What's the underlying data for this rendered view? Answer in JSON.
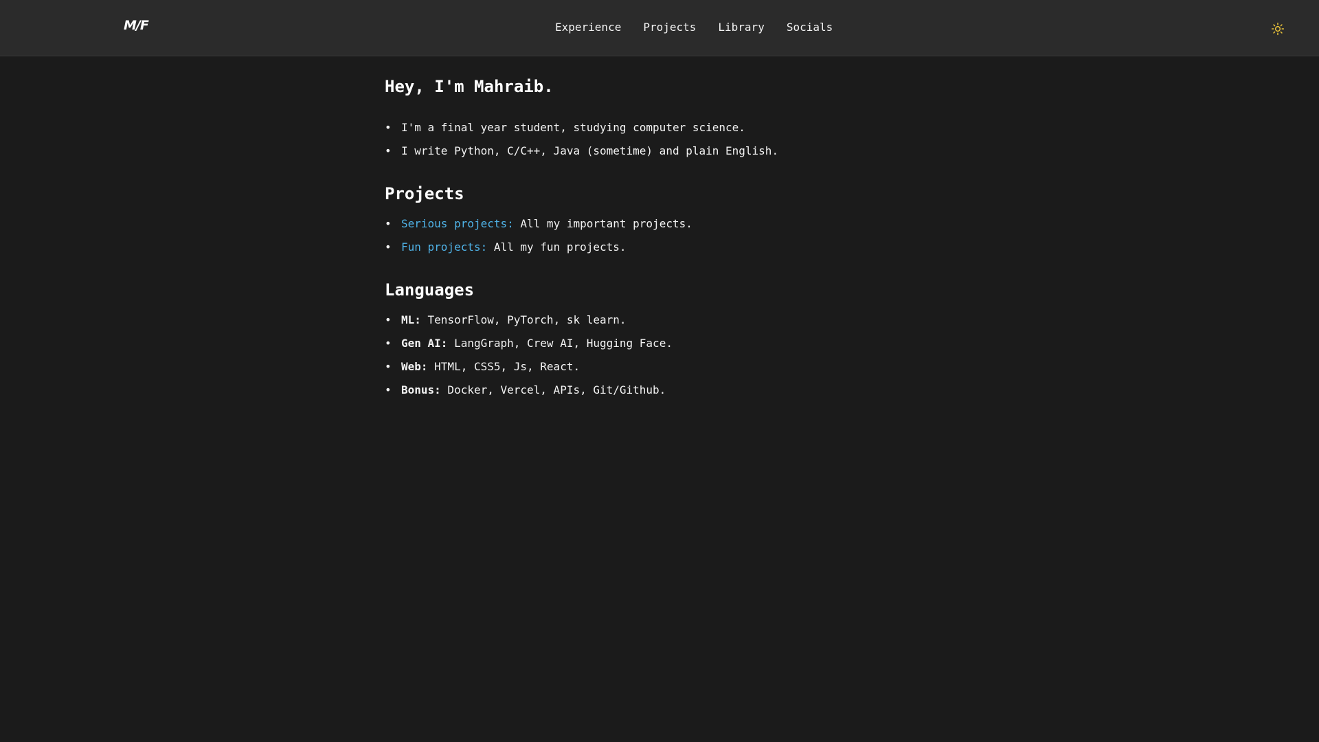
{
  "header": {
    "logo_text": "M/F",
    "nav": [
      {
        "label": "Experience"
      },
      {
        "label": "Projects"
      },
      {
        "label": "Library"
      },
      {
        "label": "Socials"
      }
    ],
    "theme_icon": "sun-icon",
    "theme_icon_color": "#e8c23a"
  },
  "intro": {
    "title": "Hey, I'm Mahraib.",
    "items": [
      "I'm a final year student, studying computer science.",
      "I write Python, C/C++, Java (sometime) and plain English."
    ]
  },
  "projects": {
    "title": "Projects",
    "items": [
      {
        "link": "Serious projects:",
        "text": " All my important projects."
      },
      {
        "link": "Fun projects:",
        "text": " All my fun projects."
      }
    ],
    "link_color": "#4fb3e8"
  },
  "languages": {
    "title": "Languages",
    "items": [
      {
        "label": "ML:",
        "text": " TensorFlow, PyTorch, sk learn."
      },
      {
        "label": "Gen AI:",
        "text": " LangGraph, Crew AI, Hugging Face."
      },
      {
        "label": "Web:",
        "text": " HTML, CSS5, Js, React."
      },
      {
        "label": "Bonus:",
        "text": " Docker, Vercel, APIs, Git/Github."
      }
    ]
  }
}
